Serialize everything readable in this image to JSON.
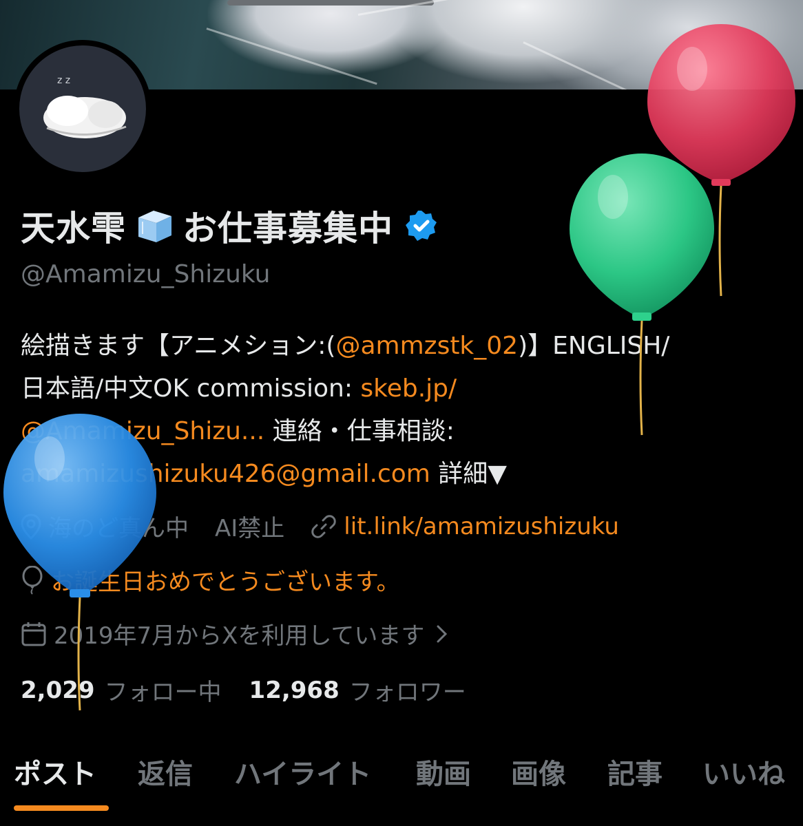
{
  "profile": {
    "name_part1": "天水雫",
    "name_part2": "お仕事募集中",
    "handle": "@Amamizu_Shizuku",
    "bio": {
      "line1_text": "絵描きます【アニメション:(",
      "line1_link": "@ammzstk_02",
      "line1_tail": ")】ENGLISH/",
      "line2_text": "日本語/中文OK commission: ",
      "line2_link": "skeb.jp/",
      "line3_link": "@Amamizu_Shizu...",
      "line3_text": " 連絡・仕事相談:",
      "line4_link": "amamizushizuku426@gmail.com",
      "line4_text": " 詳細▼"
    },
    "location": "海のど真ん中",
    "note": "AI禁止",
    "website": "lit.link/amamizushizuku",
    "birthday": "お誕生日おめでとうございます。",
    "joined": "2019年7月からXを利用しています"
  },
  "stats": {
    "following_count": "2,029",
    "following_label": "フォロー中",
    "followers_count": "12,968",
    "followers_label": "フォロワー"
  },
  "tabs": [
    {
      "label": "ポスト",
      "active": true
    },
    {
      "label": "返信"
    },
    {
      "label": "ハイライト"
    },
    {
      "label": "動画"
    },
    {
      "label": "画像"
    },
    {
      "label": "記事"
    },
    {
      "label": "いいね"
    }
  ],
  "colors": {
    "accent": "#f58a1f",
    "verified": "#1d9bf0",
    "muted": "#71767b",
    "balloon_red": "#e23a5b",
    "balloon_green": "#2ed18c",
    "balloon_blue": "#2a8ee8"
  },
  "icons": [
    "ice-cube-icon",
    "verified-badge-icon",
    "location-pin-icon",
    "link-icon",
    "balloon-icon",
    "calendar-icon",
    "chevron-right-icon"
  ]
}
